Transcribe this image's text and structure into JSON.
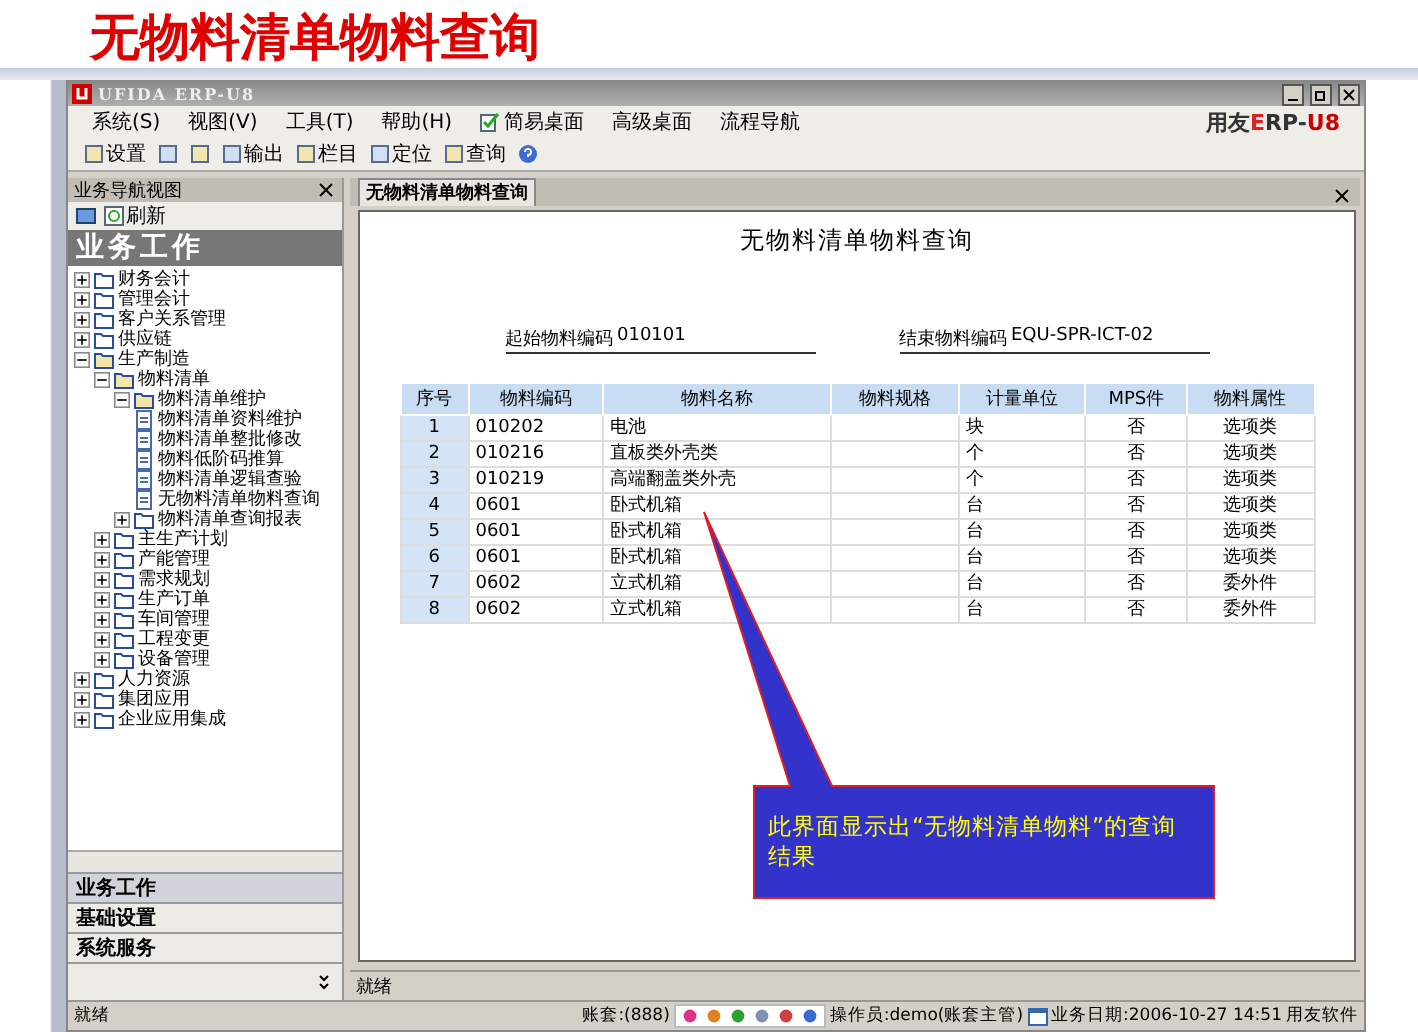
{
  "slide_title": "无物料清单物料查询",
  "window": {
    "title": "UFIDA ERP-U8",
    "brand": {
      "prefix": "用友",
      "accent": "E",
      "rest": "RP-",
      "suffix": "U8"
    }
  },
  "menu": [
    {
      "label": "系统(S)",
      "kind": "text"
    },
    {
      "label": "视图(V)",
      "kind": "text"
    },
    {
      "label": "工具(T)",
      "kind": "text"
    },
    {
      "label": "帮助(H)",
      "kind": "text"
    },
    {
      "label": "简易桌面",
      "kind": "icon"
    },
    {
      "label": "高级桌面",
      "kind": "text"
    },
    {
      "label": "流程导航",
      "kind": "text"
    }
  ],
  "toolbar": [
    {
      "kind": "labeled",
      "label": "设置"
    },
    {
      "kind": "icon"
    },
    {
      "kind": "icon"
    },
    {
      "kind": "labeled",
      "label": "输出"
    },
    {
      "kind": "labeled",
      "label": "栏目"
    },
    {
      "kind": "labeled",
      "label": "定位"
    },
    {
      "kind": "labeled",
      "label": "查询"
    }
  ],
  "nav_panel": {
    "title": "业务导航视图",
    "refresh": "刷新",
    "heading": "业务工作",
    "tree": [
      {
        "label": "财务会计",
        "expanded": false
      },
      {
        "label": "管理会计",
        "expanded": false
      },
      {
        "label": "客户关系管理",
        "expanded": false
      },
      {
        "label": "供应链",
        "expanded": false
      },
      {
        "label": "生产制造",
        "expanded": true,
        "children": [
          {
            "label": "物料清单",
            "expanded": true,
            "children": [
              {
                "label": "物料清单维护",
                "expanded": true,
                "children": [
                  {
                    "label": "物料清单资料维护",
                    "kind": "doc"
                  },
                  {
                    "label": "物料清单整批修改",
                    "kind": "doc"
                  },
                  {
                    "label": "物料低阶码推算",
                    "kind": "doc"
                  },
                  {
                    "label": "物料清单逻辑查验",
                    "kind": "doc"
                  },
                  {
                    "label": "无物料清单物料查询",
                    "kind": "doc"
                  }
                ]
              },
              {
                "label": "物料清单查询报表",
                "expanded": false
              }
            ]
          },
          {
            "label": "主生产计划",
            "expanded": false
          },
          {
            "label": "产能管理",
            "expanded": false
          },
          {
            "label": "需求规划",
            "expanded": false
          },
          {
            "label": "生产订单",
            "expanded": false
          },
          {
            "label": "车间管理",
            "expanded": false
          },
          {
            "label": "工程变更",
            "expanded": false
          },
          {
            "label": "设备管理",
            "expanded": false
          }
        ]
      },
      {
        "label": "人力资源",
        "expanded": false
      },
      {
        "label": "集团应用",
        "expanded": false
      },
      {
        "label": "企业应用集成",
        "expanded": false
      }
    ],
    "sections": [
      {
        "label": "业务工作",
        "selected": true
      },
      {
        "label": "基础设置",
        "selected": false
      },
      {
        "label": "系统服务",
        "selected": false
      }
    ]
  },
  "document": {
    "tab": "无物料清单物料查询",
    "title": "无物料清单物料查询",
    "fields": [
      {
        "label": "起始物料编码",
        "value": "010101"
      },
      {
        "label": "结束物料编码",
        "value": "EQU-SPR-ICT-02"
      }
    ],
    "table": {
      "columns": [
        "序号",
        "物料编码",
        "物料名称",
        "物料规格",
        "计量单位",
        "MPS件",
        "物料属性"
      ],
      "rows": [
        [
          "1",
          "010202",
          "电池",
          "",
          "块",
          "否",
          "选项类"
        ],
        [
          "2",
          "010216",
          "直板类外壳类",
          "",
          "个",
          "否",
          "选项类"
        ],
        [
          "3",
          "010219",
          "高端翻盖类外壳",
          "",
          "个",
          "否",
          "选项类"
        ],
        [
          "4",
          "0601",
          "卧式机箱",
          "",
          "台",
          "否",
          "选项类"
        ],
        [
          "5",
          "0601",
          "卧式机箱",
          "",
          "台",
          "否",
          "选项类"
        ],
        [
          "6",
          "0601",
          "卧式机箱",
          "",
          "台",
          "否",
          "选项类"
        ],
        [
          "7",
          "0602",
          "立式机箱",
          "",
          "台",
          "否",
          "委外件"
        ],
        [
          "8",
          "0602",
          "立式机箱",
          "",
          "台",
          "否",
          "委外件"
        ]
      ]
    },
    "status": "就绪"
  },
  "callout": "此界面显示出“无物料清单物料”的查询结果",
  "status_bar": {
    "left": "就绪",
    "account": "账套:(888)",
    "operator": "操作员:demo(账套主管)",
    "date": "业务日期:2006-10-27 14:51",
    "company": "用友软件"
  }
}
